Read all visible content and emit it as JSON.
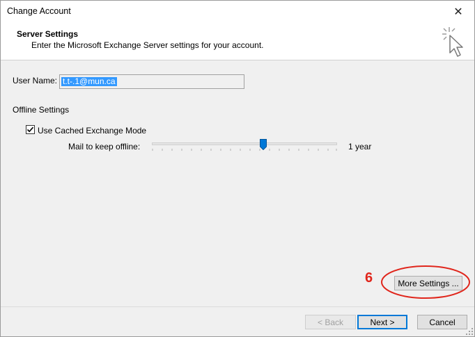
{
  "window": {
    "title": "Change Account",
    "close_label": "✕"
  },
  "header": {
    "title": "Server Settings",
    "subtitle": "Enter the Microsoft Exchange Server settings for your account.",
    "icon": "cursor-click-icon"
  },
  "form": {
    "username_label": "User Name:",
    "username_value": "t.t-.1@mun.ca",
    "offline_section_label": "Offline Settings",
    "cached_mode_label": "Use Cached Exchange Mode",
    "cached_mode_checked": true,
    "mail_offline_label": "Mail to keep offline:",
    "mail_offline_value": "1 year",
    "slider_position": 0.6
  },
  "annotation": {
    "step_number": "6",
    "color": "#e0251b"
  },
  "buttons": {
    "more_settings": "More Settings ...",
    "back": "< Back",
    "next": "Next >",
    "cancel": "Cancel"
  }
}
